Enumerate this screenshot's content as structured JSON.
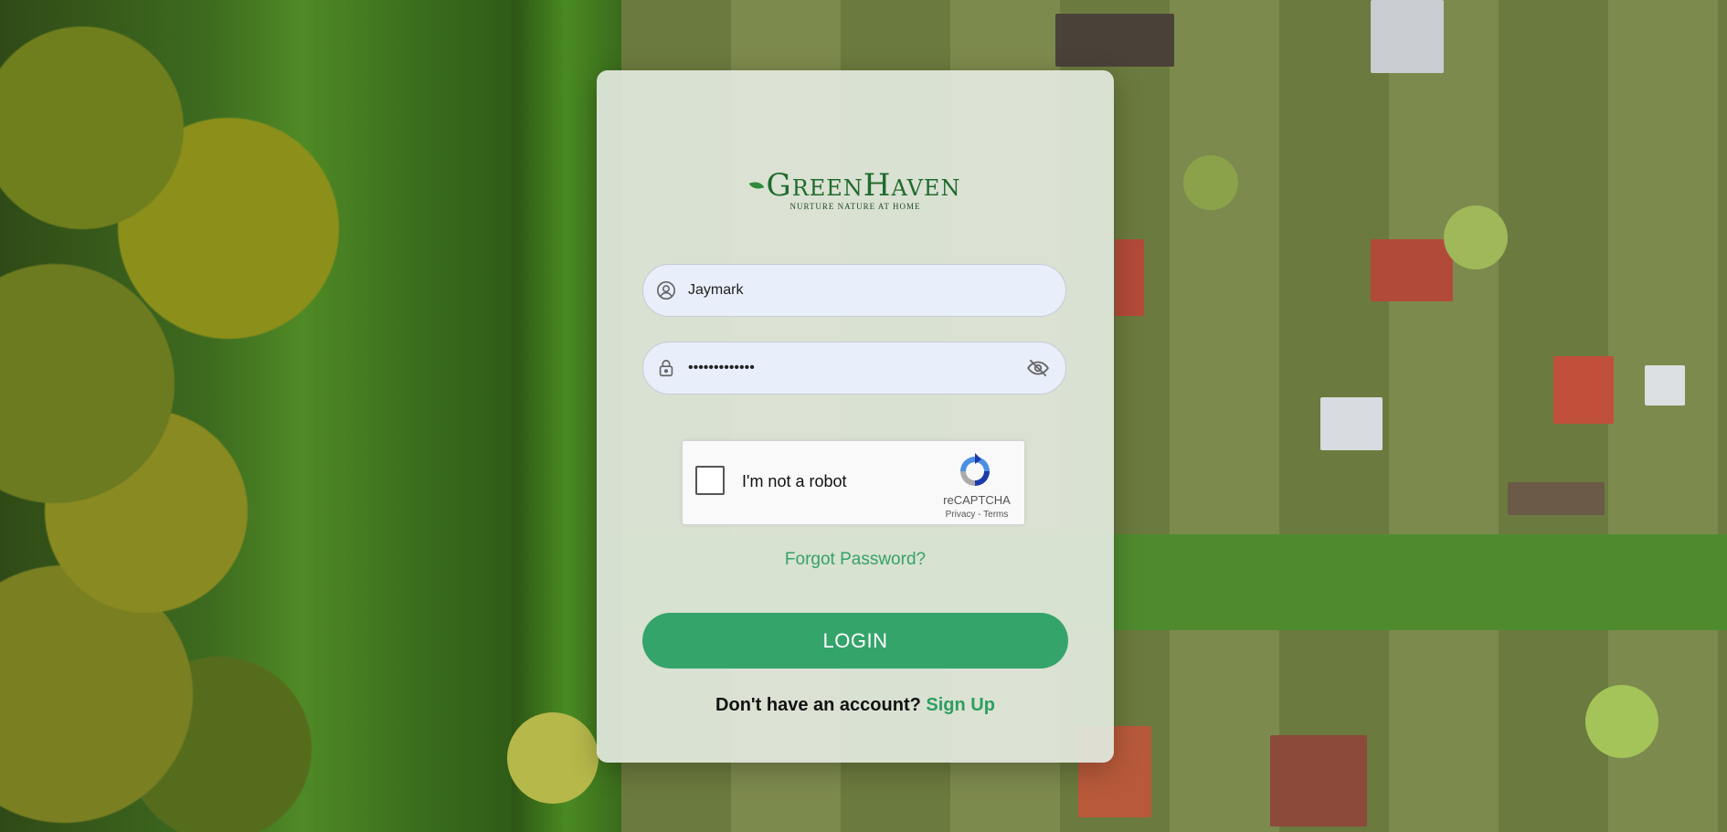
{
  "brand": {
    "name": "GreenHaven",
    "tagline": "NURTURE NATURE AT HOME",
    "color": "#1f6b2c"
  },
  "form": {
    "username": {
      "icon": "user-circle-icon",
      "value": "Jaymark"
    },
    "password": {
      "icon": "lock-icon",
      "value": "•••••••••••••",
      "toggle_icon": "eye-off-icon"
    },
    "recaptcha": {
      "label": "I'm not a robot",
      "brand": "reCAPTCHA",
      "privacy": "Privacy",
      "separator": " - ",
      "terms": "Terms",
      "checked": false
    },
    "forgot_password": "Forgot Password?",
    "login_label": "LOGIN",
    "signup_prompt": "Don't have an account?",
    "signup_link": "Sign Up"
  },
  "colors": {
    "accent": "#34a46a",
    "link": "#38a169",
    "field_bg": "#e8eefa"
  }
}
